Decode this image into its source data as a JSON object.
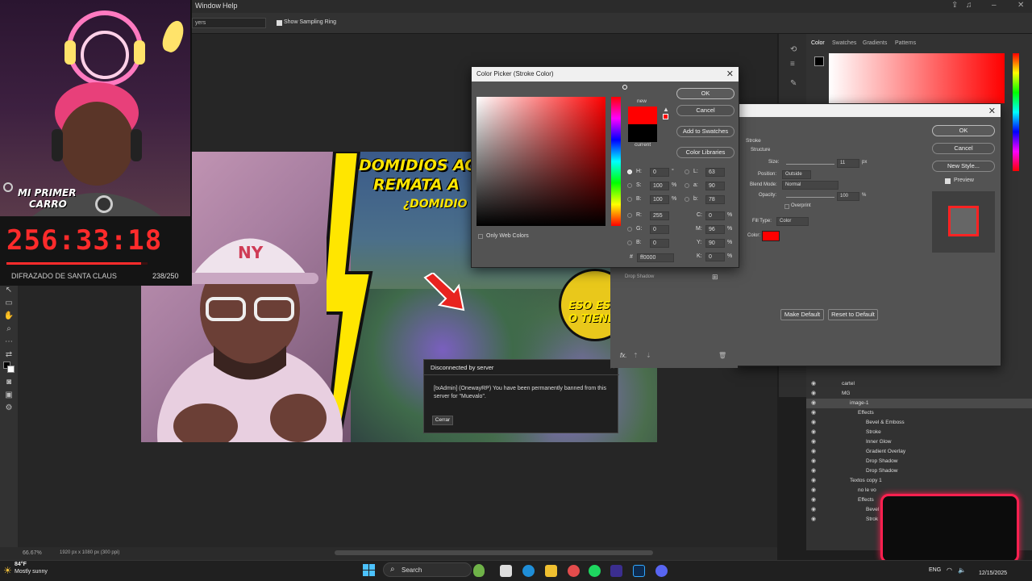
{
  "menubar": {
    "window": "Window",
    "help": "Help"
  },
  "options": {
    "sampling_ring": "Show Sampling Ring",
    "layers_text": "yers"
  },
  "status": {
    "zoom": "66.67%",
    "doc_info": "1920 px x 1080 px (300 ppi)"
  },
  "overlay": {
    "carro_line1": "MI PRIMER",
    "carro_line2": "CARRO",
    "timer": "256:33:18",
    "timer_label": "DIFRAZADO DE SANTA CLAUS",
    "timer_count": "238/250",
    "progress_fraction": 0.952
  },
  "artwork": {
    "headline_line1": "DOMIDIOS AC",
    "headline_line2": "REMATA A",
    "headline_line3": "¿DOMIDIO",
    "eso_line1": "ESO ES",
    "eso_line2": "O TIENE",
    "cap": "NY"
  },
  "disconnect": {
    "title": "Disconnected by server",
    "message": "[txAdmin] (OnewayRP) You have been permanently banned from this server for \"Muevalo\".",
    "button": "Cerrar"
  },
  "color_picker": {
    "title": "Color Picker (Stroke Color)",
    "ok": "OK",
    "cancel": "Cancel",
    "add_swatches": "Add to Swatches",
    "libraries": "Color Libraries",
    "new_label": "new",
    "current_label": "current",
    "only_web": "Only Web Colors",
    "new_color": "#ff0000",
    "current_color": "#000000",
    "fields": {
      "H": "0",
      "H_unit": "°",
      "S": "100",
      "S_unit": "%",
      "B": "100",
      "B_unit": "%",
      "R": "255",
      "G": "0",
      "Bl": "0",
      "L": "63",
      "a": "90",
      "b": "78",
      "C": "0",
      "M": "96",
      "Y": "90",
      "K": "0",
      "pct": "%",
      "hex": "ff0000"
    }
  },
  "layer_style": {
    "ok": "OK",
    "cancel": "Cancel",
    "new_style": "New Style...",
    "preview": "Preview",
    "stroke": "Stroke",
    "structure": "Structure",
    "size_label": "Size:",
    "size_val": "11",
    "size_unit": "px",
    "position_label": "Position:",
    "position_val": "Outside",
    "blend_label": "Blend Mode:",
    "blend_val": "Normal",
    "opacity_label": "Opacity:",
    "opacity_val": "100",
    "opacity_unit": "%",
    "overprint": "Overprint",
    "fill_type_label": "Fill Type:",
    "fill_type_val": "Color",
    "color_label": "Color:",
    "drop_shadow": "Drop Shadow",
    "make_default": "Make Default",
    "reset_default": "Reset to Default",
    "fx": "fx."
  },
  "panel": {
    "tabs": [
      "Color",
      "Swatches",
      "Gradients",
      "Patterns"
    ]
  },
  "layers": [
    {
      "name": "cartel",
      "indent": 0
    },
    {
      "name": "MG",
      "indent": 0
    },
    {
      "name": "image-1",
      "indent": 1
    },
    {
      "name": "Effects",
      "indent": 2
    },
    {
      "name": "Bevel & Emboss",
      "indent": 3
    },
    {
      "name": "Stroke",
      "indent": 3
    },
    {
      "name": "Inner Glow",
      "indent": 3
    },
    {
      "name": "Gradient Overlay",
      "indent": 3
    },
    {
      "name": "Drop Shadow",
      "indent": 3
    },
    {
      "name": "Drop Shadow",
      "indent": 3
    },
    {
      "name": "Textos copy 1",
      "indent": 1
    },
    {
      "name": "no le vo",
      "indent": 2
    },
    {
      "name": "Effects",
      "indent": 2
    },
    {
      "name": "Bevel",
      "indent": 3
    },
    {
      "name": "Strok",
      "indent": 3
    }
  ],
  "taskbar": {
    "temp": "84°F",
    "weather": "Mostly sunny",
    "search": "Search",
    "lang": "ENG",
    "date": "12/15/2025"
  },
  "colors": {
    "accent_red": "#ff0000",
    "timer_red": "#ff2b2b",
    "neon_pink": "#ff2050",
    "headline_yellow": "#ffe600"
  }
}
